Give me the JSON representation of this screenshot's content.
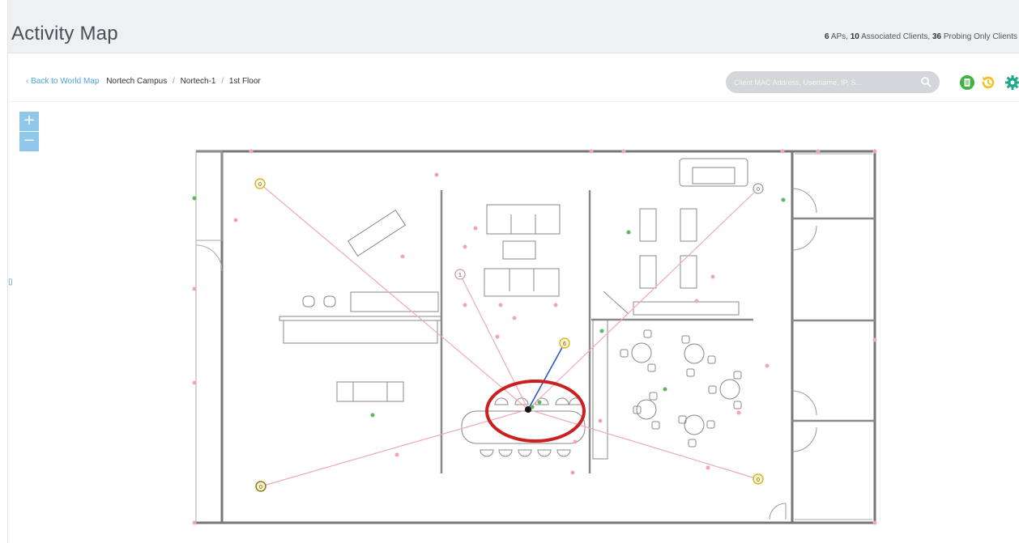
{
  "header": {
    "title": "Activity Map",
    "summary": {
      "aps_count": "6",
      "aps_label": "APs,",
      "associated_count": "10",
      "associated_label": "Associated Clients,",
      "probing_count": "36",
      "probing_label": "Probing Only Clients"
    }
  },
  "breadcrumb": {
    "back_label": "Back to World Map",
    "items": [
      "Nortech Campus",
      "Nortech-1",
      "1st Floor"
    ],
    "separator": "/"
  },
  "search": {
    "placeholder": "Client MAC Address, Username, IP, S..."
  },
  "toolbar": {
    "icons": [
      "document-icon",
      "history-icon",
      "gear-icon"
    ]
  },
  "zoom": {
    "in_label": "+",
    "out_label": "−"
  },
  "floor_map": {
    "access_points": [
      {
        "label": "0"
      },
      {
        "label": "0"
      },
      {
        "label": "1"
      },
      {
        "label": "6"
      },
      {
        "label": "0"
      },
      {
        "label": "0"
      }
    ],
    "colors": {
      "ap_ring": "#d4b83a",
      "probe_dot": "#f2a5b4",
      "probe_line": "#efa9b6",
      "associated_dot": "#5cb85c",
      "association_line": "#2c55c8",
      "highlight_circle": "#cc1f1f",
      "wall": "#777777"
    }
  }
}
